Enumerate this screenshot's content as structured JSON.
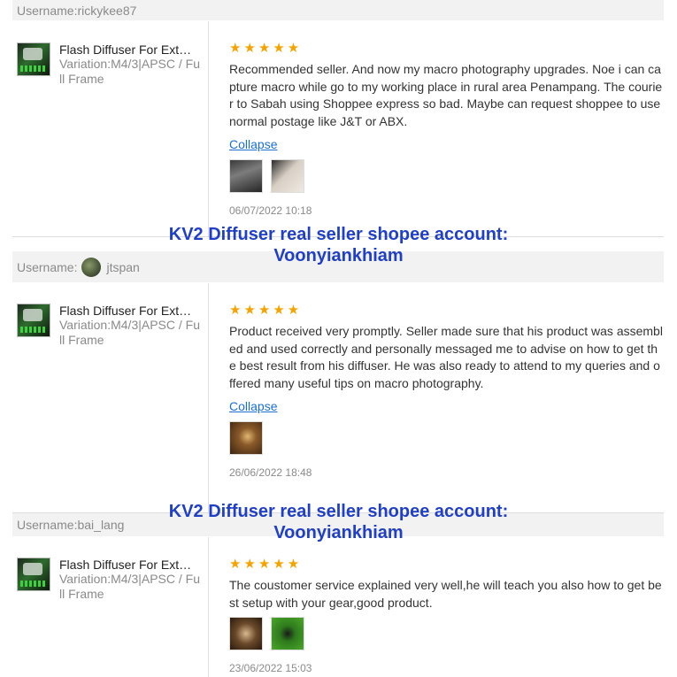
{
  "reviews": [
    {
      "username_label": "Username:rickykee87",
      "username_prefix": "",
      "username_name": "",
      "product_name": "Flash Diffuser For Extr...",
      "variation": "Variation:M4/3|APSC / Full Frame",
      "rating": "★★★★★",
      "comment": "Recommended seller. And now my macro photography upgrades. Noe i can capture macro while go to my working place in rural area Penampang. The courier to Sabah using Shoppee express so bad. Maybe can request shoppee to use normal postage like J&T or ABX.",
      "collapse_label": "Collapse",
      "date": "06/07/2022 10:18"
    },
    {
      "username_label": "",
      "username_prefix": "Username:",
      "username_name": "jtspan",
      "product_name": "Flash Diffuser For Extr...",
      "variation": "Variation:M4/3|APSC / Full Frame",
      "rating": "★★★★★",
      "comment": "Product received very promptly. Seller made sure that his product was assembled and used correctly and personally messaged me to advise on how to get the best result from his diffuser. He was also ready to attend to my queries and offered many useful tips on macro photography.",
      "collapse_label": "Collapse",
      "date": "26/06/2022 18:48"
    },
    {
      "username_label": "Username:bai_lang",
      "username_prefix": "",
      "username_name": "",
      "product_name": "Flash Diffuser For Extr...",
      "variation": "Variation:M4/3|APSC / Full Frame",
      "rating": "★★★★★",
      "comment": "The coustomer service explained very well,he will teach you also how to get best setup with your gear,good product.",
      "collapse_label": "",
      "date": "23/06/2022 15:03"
    }
  ],
  "watermark": {
    "line1": "KV2 Diffuser real seller shopee account:",
    "line2": "Voonyiankhiam"
  },
  "colors": {
    "star": "#f5a300",
    "link": "#1a6fd1",
    "watermark": "#1f3fc8"
  }
}
